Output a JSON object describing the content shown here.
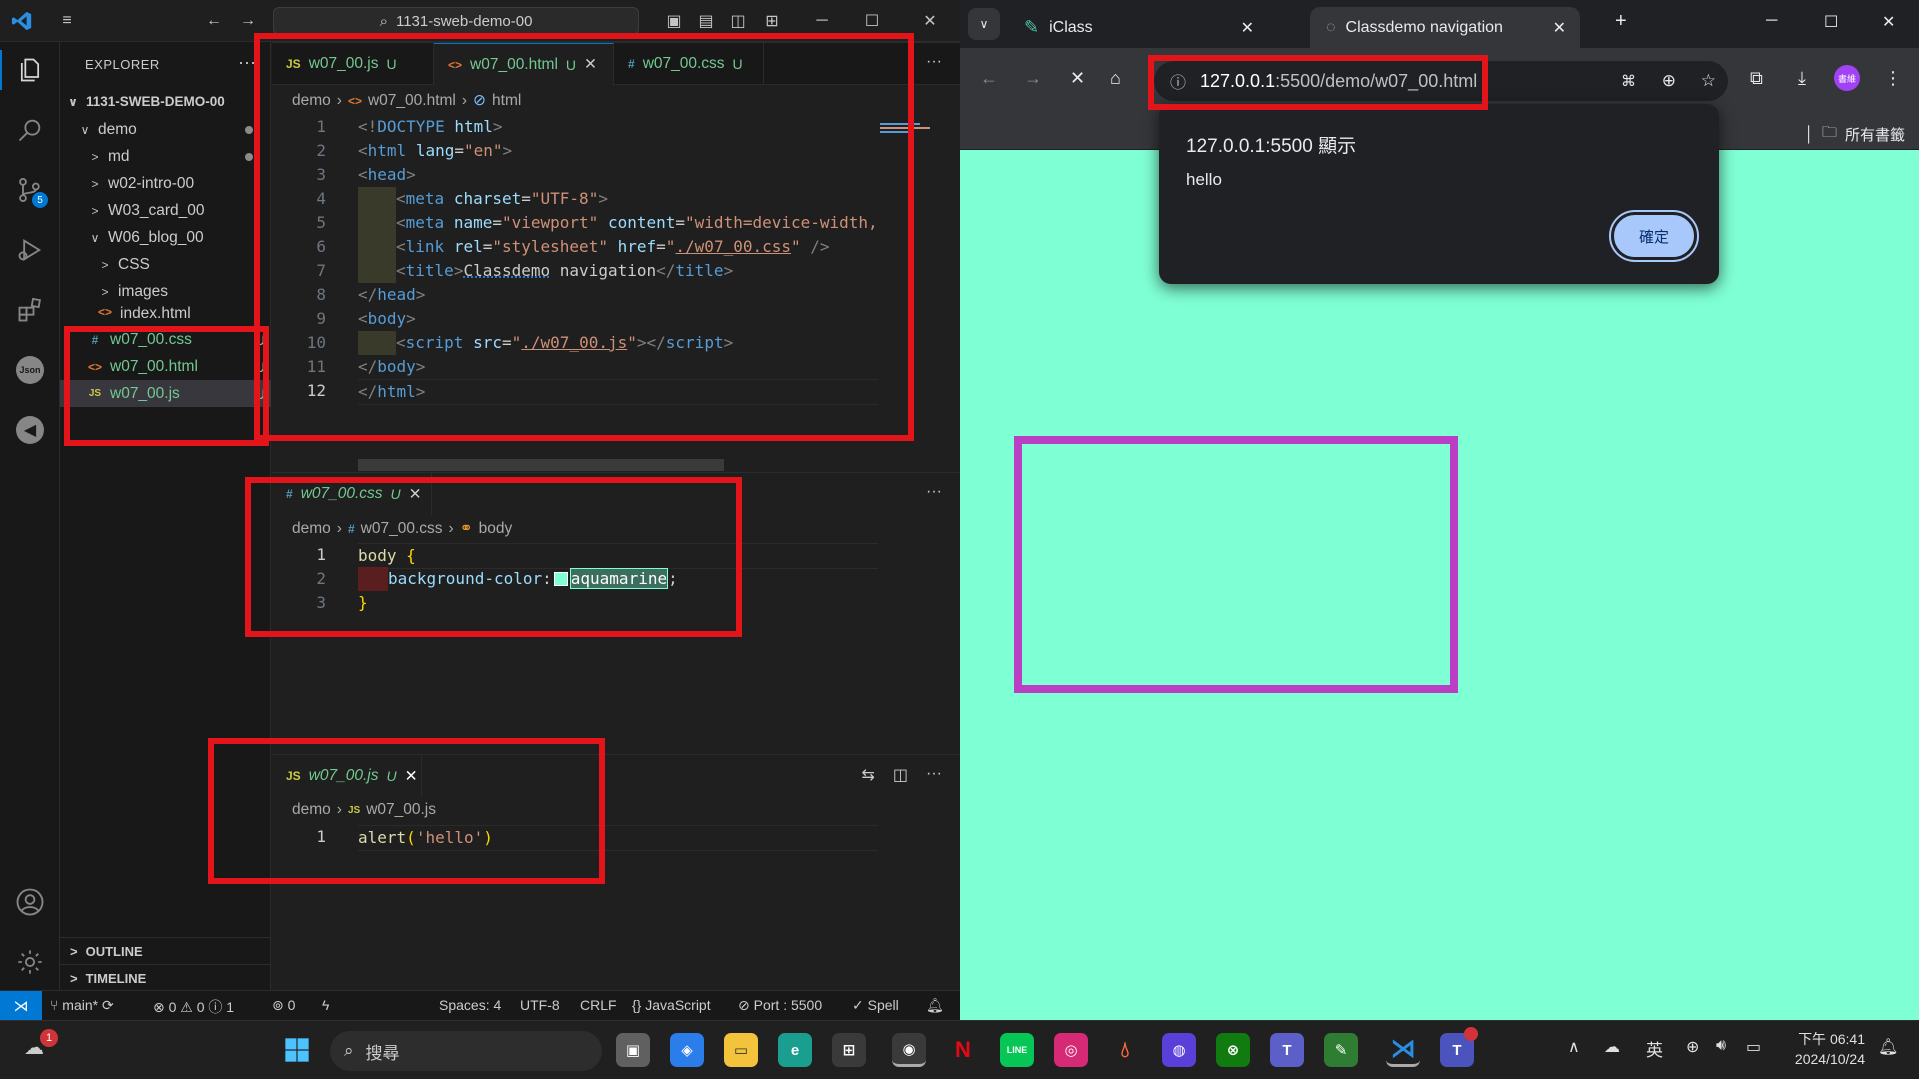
{
  "vscode": {
    "search_text": "1131-sweb-demo-00",
    "explorer": {
      "title": "EXPLORER",
      "root": "1131-SWEB-DEMO-00",
      "items": [
        {
          "label": "demo",
          "chev": "∨",
          "depth": 1
        },
        {
          "label": "md",
          "chev": ">",
          "depth": 2
        },
        {
          "label": "w02-intro-00",
          "chev": ">",
          "depth": 2
        },
        {
          "label": "W03_card_00",
          "chev": ">",
          "depth": 2
        },
        {
          "label": "W06_blog_00",
          "chev": "∨",
          "depth": 2
        },
        {
          "label": "CSS",
          "chev": ">",
          "depth": 3
        },
        {
          "label": "images",
          "chev": ">",
          "depth": 3
        },
        {
          "label": "index.html",
          "chev": "",
          "depth": 3
        }
      ],
      "files": [
        {
          "label": "w07_00.css",
          "icon": "#",
          "badge": "U"
        },
        {
          "label": "w07_00.html",
          "icon": "<>",
          "badge": "U"
        },
        {
          "label": "w07_00.js",
          "icon": "JS",
          "badge": "U"
        }
      ],
      "outline": "OUTLINE",
      "timeline": "TIMELINE"
    },
    "editor1": {
      "tabs": [
        {
          "icon": "JS",
          "label": "w07_00.js",
          "badge": "U"
        },
        {
          "icon": "<>",
          "label": "w07_00.html",
          "badge": "U"
        },
        {
          "icon": "#",
          "label": "w07_00.css",
          "badge": "U"
        }
      ],
      "breadcrumb": [
        "demo",
        "w07_00.html",
        "html"
      ],
      "lines": [
        "1",
        "2",
        "3",
        "4",
        "5",
        "6",
        "7",
        "8",
        "9",
        "10",
        "11",
        "12"
      ]
    },
    "editor2": {
      "tab": {
        "icon": "#",
        "label": "w07_00.css",
        "badge": "U"
      },
      "breadcrumb": [
        "demo",
        "w07_00.css",
        "body"
      ],
      "lines": [
        "1",
        "2",
        "3"
      ]
    },
    "editor3": {
      "tab": {
        "icon": "JS",
        "label": "w07_00.js",
        "badge": "U"
      },
      "breadcrumb": [
        "demo",
        "w07_00.js"
      ],
      "lines": [
        "1"
      ]
    },
    "statusbar": {
      "branch": "main*",
      "problems": "⊗ 0 ⚠ 0 ⓘ 1",
      "ports": "0",
      "spaces": "Spaces: 4",
      "encoding": "UTF-8",
      "eol": "CRLF",
      "language": "JavaScript",
      "port": "Port : 5500",
      "spell": "Spell"
    }
  },
  "chrome": {
    "tabs": [
      {
        "label": "iClass"
      },
      {
        "label": "Classdemo navigation"
      }
    ],
    "url_host": "127.0.0.1",
    "url_rest": ":5500/demo/w07_00.html",
    "bookmark": "所有書籤",
    "profile": "書維",
    "dialog": {
      "title": "127.0.0.1:5500 顯示",
      "message": "hello",
      "ok": "確定"
    },
    "page_bg": "#7fffd4"
  },
  "taskbar": {
    "search_placeholder": "搜尋",
    "notification_count": "1",
    "ime": "英",
    "time": "下午 06:41",
    "date": "2024/10/24"
  },
  "colors": {
    "annotation_red": "#e3151a",
    "box_purple": "#bb3fc4",
    "accent_blue": "#0078d4"
  }
}
